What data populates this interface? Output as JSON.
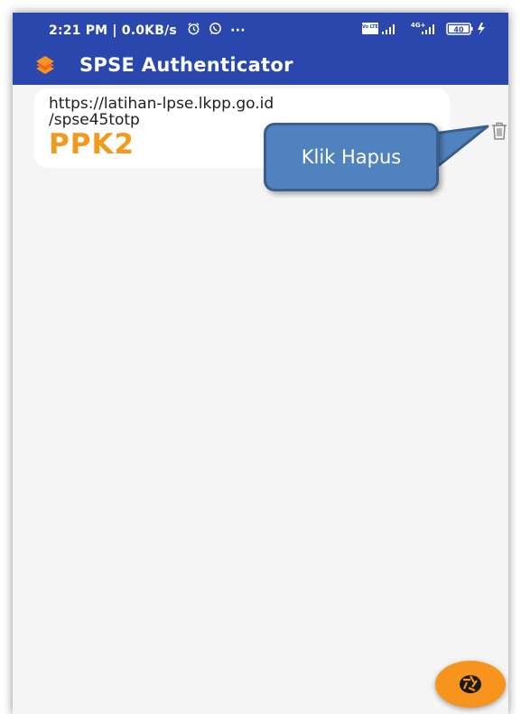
{
  "status_bar": {
    "time_net": "2:21 PM | 0.0KB/s",
    "more": "···",
    "volte": "Vo LTE",
    "net_type": "4G+",
    "battery": "40"
  },
  "app": {
    "title": "SPSE Authenticator"
  },
  "account": {
    "url_line1": "https://latihan-lpse.lkpp.go.id",
    "url_line2": "/spse45totp",
    "code": "PPK2"
  },
  "callout": {
    "text": "Klik Hapus"
  },
  "colors": {
    "app_bar": "#2947ad",
    "code": "#f39a1c",
    "fab": "#f7941d",
    "callout": "#4f82bf",
    "background": "#f5f5f5"
  },
  "icons": {
    "delete": "trash-icon",
    "fab": "camera-shutter-icon",
    "logo": "spse-logo-icon"
  }
}
